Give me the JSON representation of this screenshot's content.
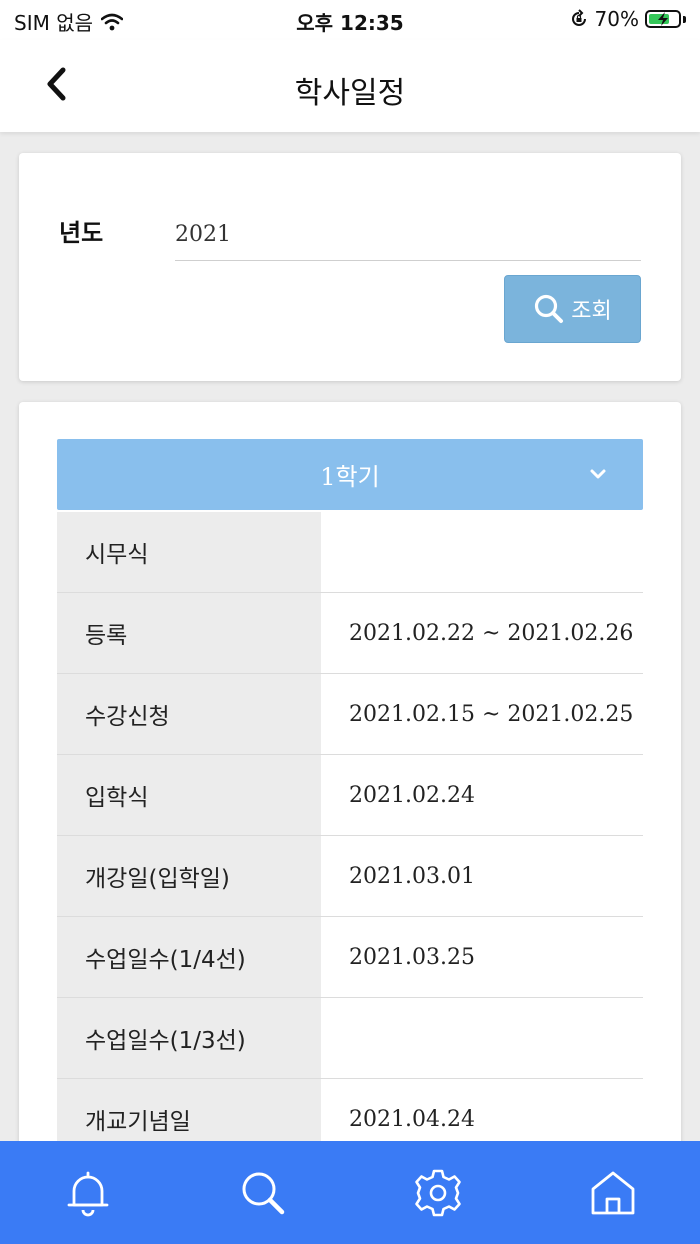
{
  "status_bar": {
    "carrier": "SIM 없음",
    "time": "오후 12:35",
    "battery_percent": "70%",
    "battery_level": 0.7
  },
  "header": {
    "title": "학사일정"
  },
  "search": {
    "year_label": "년도",
    "year_value": "2021",
    "button_label": "조회"
  },
  "schedule": {
    "semester": "1학기",
    "rows": [
      {
        "label": "시무식",
        "value": ""
      },
      {
        "label": "등록",
        "value": "2021.02.22 ~ 2021.02.26"
      },
      {
        "label": "수강신청",
        "value": "2021.02.15 ~ 2021.02.25"
      },
      {
        "label": "입학식",
        "value": "2021.02.24"
      },
      {
        "label": "개강일(입학일)",
        "value": "2021.03.01"
      },
      {
        "label": "수업일수(1/4선)",
        "value": "2021.03.25"
      },
      {
        "label": "수업일수(1/3선)",
        "value": ""
      },
      {
        "label": "개교기념일",
        "value": "2021.04.24"
      }
    ]
  },
  "tab_bar": {
    "items": [
      "bell-icon",
      "search-icon",
      "gear-icon",
      "home-icon"
    ]
  },
  "colors": {
    "accent": "#3a7bf5",
    "search_button": "#7bb4dc",
    "semester_header": "#89bfed",
    "battery": "#34c759"
  }
}
